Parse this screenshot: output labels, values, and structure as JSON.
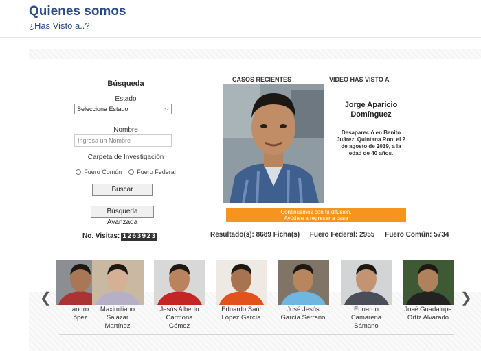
{
  "header": {
    "title": "Quienes somos",
    "subtitle": "¿Has Visto a..?"
  },
  "search": {
    "title": "Búsqueda",
    "estado_label": "Estado",
    "estado_selected": "Selecciona Estado",
    "nombre_label": "Nombre",
    "nombre_placeholder": "Ingresa un Nombre",
    "carpeta_label": "Carpeta de Investigación",
    "radio_comun": "Fuero Común",
    "radio_federal": "Fuero Federal",
    "search_button": "Buscar",
    "advanced_button": "Búsqueda Avanzada",
    "visits_label": "No. Visitas:",
    "visits_value": "1263923"
  },
  "featured": {
    "cases_label": "CASOS RECIENTES",
    "video_label": "VIDEO HAS VISTO A",
    "name": "Jorge Aparicio Domínguez",
    "description": "Desapareció en Benito Juárez, Quintana Roo, el 2 de agosto de 2019, a la edad de 40 años.",
    "banner_line1": "Continuamos con tu difusión.",
    "banner_line2": "Ayúdale a regresar a casa"
  },
  "stats": {
    "resultados": "Resultado(s): 8689 Ficha(s)",
    "federal": "Fuero Federal: 2955",
    "comun": "Fuero Común: 5734"
  },
  "carousel": {
    "prev_icon": "chevron-left-icon",
    "next_icon": "chevron-right-icon",
    "people": [
      {
        "name": "andro\nópez"
      },
      {
        "name": "Maximiliano\nSalazar\nMartínez"
      },
      {
        "name": "Jesús Alberto\nCarmona\nGómez"
      },
      {
        "name": "Eduardo Saúl\nLópez García"
      },
      {
        "name": "José Jesús\nGarcía Serrano"
      },
      {
        "name": "Eduardo\nCamarena\nSámano"
      },
      {
        "name": "José Guadalupe\nOrtíz Alvarado"
      }
    ]
  }
}
